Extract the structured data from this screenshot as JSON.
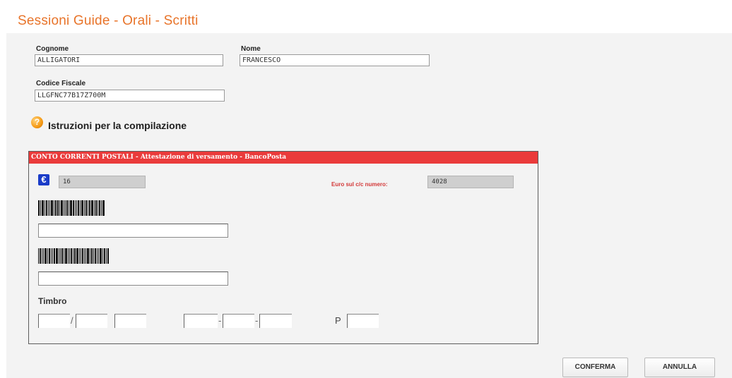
{
  "header": {
    "title": "Sessioni Guide - Orali - Scritti"
  },
  "form": {
    "cognome": {
      "label": "Cognome",
      "value": "ALLIGATORI"
    },
    "nome": {
      "label": "Nome",
      "value": "FRANCESCO"
    },
    "codice_fiscale": {
      "label": "Codice Fiscale",
      "value": "LLGFNC77B17Z700M"
    },
    "help_link": "Istruzioni per la compilazione"
  },
  "bollettino": {
    "header": "CONTO CORRENTI POSTALI - Attestazione di versamento - BancoPosta",
    "amount": "16",
    "account_label": "Euro sul c/c numero:",
    "account_number": "4028",
    "stamp_label": "Timbro",
    "p_label": "P"
  },
  "buttons": {
    "confirm": "CONFERMA",
    "cancel": "ANNULLA"
  },
  "colors": {
    "title": "#e8742a",
    "header_bar": "#ea3b3b",
    "euro_icon": "#1a3cc8"
  },
  "icons": [
    "help-icon",
    "euro-icon",
    "barcode-icon"
  ]
}
